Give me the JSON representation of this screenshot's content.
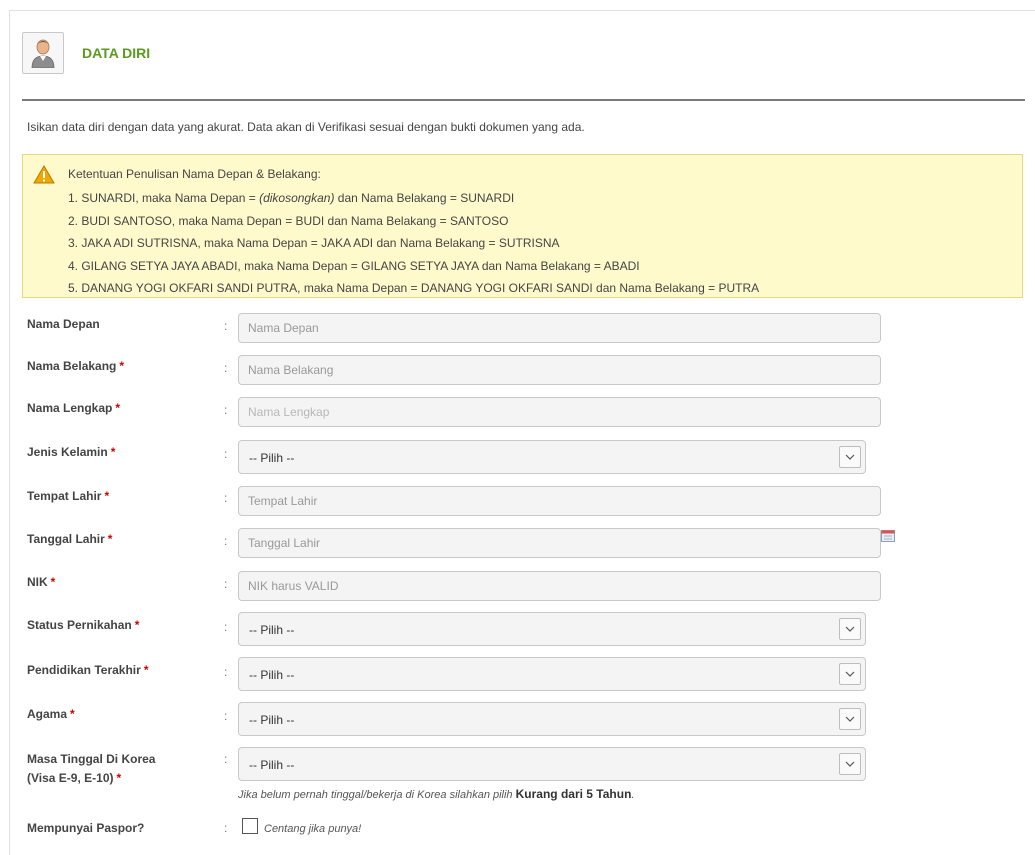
{
  "section": {
    "title": "DATA DIRI"
  },
  "intro": "Isikan data diri dengan data yang akurat. Data akan di Verifikasi sesuai dengan bukti dokumen yang ada.",
  "notice": {
    "title": "Ketentuan Penulisan Nama Depan & Belakang:",
    "items": [
      {
        "pre": "1. SUNARDI, maka Nama Depan = ",
        "em": "(dikosongkan)",
        "post": " dan Nama Belakang = SUNARDI"
      },
      {
        "pre": "2. BUDI SANTOSO, maka Nama Depan = BUDI dan Nama Belakang = SANTOSO",
        "em": "",
        "post": ""
      },
      {
        "pre": "3. JAKA ADI SUTRISNA, maka Nama Depan = JAKA ADI dan Nama Belakang = SUTRISNA",
        "em": "",
        "post": ""
      },
      {
        "pre": "4. GILANG SETYA JAYA ABADI, maka Nama Depan = GILANG SETYA JAYA dan Nama Belakang = ABADI",
        "em": "",
        "post": ""
      },
      {
        "pre": "5. DANANG YOGI OKFARI SANDI PUTRA, maka Nama Depan = DANANG YOGI OKFARI SANDI dan Nama Belakang = PUTRA",
        "em": "",
        "post": ""
      }
    ]
  },
  "colon": ":",
  "required_mark": "*",
  "fields": {
    "nama_depan": {
      "label": "Nama Depan",
      "placeholder": "Nama Depan",
      "value": ""
    },
    "nama_belakang": {
      "label": "Nama Belakang",
      "placeholder": "Nama Belakang",
      "value": ""
    },
    "nama_lengkap": {
      "label": "Nama Lengkap",
      "placeholder": "Nama Lengkap",
      "value": ""
    },
    "jenis_kelamin": {
      "label": "Jenis Kelamin",
      "selected": "-- Pilih --"
    },
    "tempat_lahir": {
      "label": "Tempat Lahir",
      "placeholder": "Tempat Lahir",
      "value": ""
    },
    "tanggal_lahir": {
      "label": "Tanggal Lahir",
      "placeholder": "Tanggal Lahir",
      "value": ""
    },
    "nik": {
      "label": "NIK",
      "placeholder": "NIK harus VALID",
      "value": ""
    },
    "status_pernikahan": {
      "label": "Status Pernikahan",
      "selected": "-- Pilih --"
    },
    "pendidikan_terakhir": {
      "label": "Pendidikan Terakhir",
      "selected": "-- Pilih --"
    },
    "agama": {
      "label": "Agama",
      "selected": "-- Pilih --"
    },
    "masa_tinggal": {
      "label_line1": "Masa Tinggal Di Korea",
      "label_line2": "(Visa E-9, E-10)",
      "selected": "-- Pilih --",
      "hint_pre": "Jika belum pernah tinggal/bekerja di Korea silahkan pilih ",
      "hint_bold": "Kurang dari 5 Tahun",
      "hint_post": "."
    },
    "paspor": {
      "label": "Mempunyai Paspor?",
      "checkbox_label": "Centang jika punya!",
      "checked": false
    }
  },
  "colors": {
    "title_green": "#5a9a1e",
    "notice_bg": "#fffacc",
    "required_red": "#cc0000"
  },
  "icons": {
    "section": "user-avatar-icon",
    "notice": "warning-icon",
    "select": "chevron-down-icon",
    "date": "calendar-icon"
  }
}
